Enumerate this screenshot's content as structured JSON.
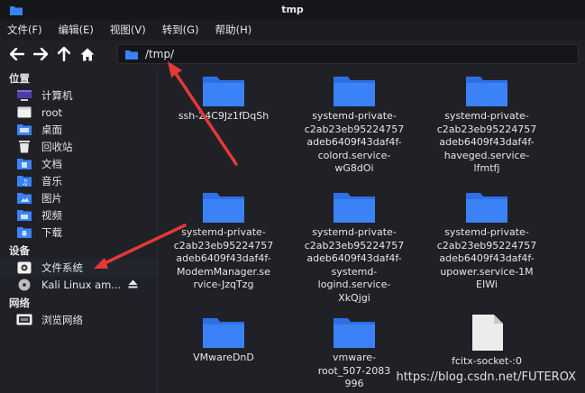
{
  "window": {
    "title": "tmp"
  },
  "menu": [
    "文件(F)",
    "编辑(E)",
    "视图(V)",
    "转到(G)",
    "帮助(H)"
  ],
  "toolbar": {
    "path": "/tmp/"
  },
  "sidebar": {
    "sections": [
      {
        "heading": "位置",
        "items": [
          {
            "label": "计算机",
            "icon": "computer-icon"
          },
          {
            "label": "root",
            "icon": "home-folder-icon"
          },
          {
            "label": "桌面",
            "icon": "desktop-folder-icon"
          },
          {
            "label": "回收站",
            "icon": "trash-icon"
          },
          {
            "label": "文档",
            "icon": "documents-folder-icon"
          },
          {
            "label": "音乐",
            "icon": "music-folder-icon"
          },
          {
            "label": "图片",
            "icon": "pictures-folder-icon"
          },
          {
            "label": "视频",
            "icon": "videos-folder-icon"
          },
          {
            "label": "下载",
            "icon": "downloads-folder-icon"
          }
        ]
      },
      {
        "heading": "设备",
        "items": [
          {
            "label": "文件系统",
            "icon": "drive-icon"
          },
          {
            "label": "Kali Linux am...",
            "icon": "disc-icon",
            "eject": true
          }
        ]
      },
      {
        "heading": "网络",
        "items": [
          {
            "label": "浏览网络",
            "icon": "network-icon"
          }
        ]
      }
    ]
  },
  "files": [
    {
      "name": "ssh-24C9Jz1fDqSh",
      "type": "folder"
    },
    {
      "name": "systemd-private-c2ab23eb95224757adeb6409f43daf4f-colord.service-wG8dOi",
      "type": "folder"
    },
    {
      "name": "systemd-private-c2ab23eb95224757adeb6409f43daf4f-haveged.service-lfmtfj",
      "type": "folder"
    },
    {
      "name": "systemd-private-c2ab23eb95224757adeb6409f43daf4f-ModemManager.service-JzqTzg",
      "type": "folder"
    },
    {
      "name": "systemd-private-c2ab23eb95224757adeb6409f43daf4f-systemd-logind.service-XkQjgi",
      "type": "folder"
    },
    {
      "name": "systemd-private-c2ab23eb95224757adeb6409f43daf4f-upower.service-1MEIWi",
      "type": "folder"
    },
    {
      "name": "VMwareDnD",
      "type": "folder"
    },
    {
      "name": "vmware-root_507-2083...996",
      "type": "folder"
    },
    {
      "name": "fcitx-socket-:0",
      "type": "file"
    }
  ],
  "labels_display": [
    [
      "ssh-24C9Jz1fDqSh"
    ],
    [
      "systemd-private-",
      "c2ab23eb95224757",
      "adeb6409f43daf4f-",
      "colord.service-",
      "wG8dOi"
    ],
    [
      "systemd-private-",
      "c2ab23eb95224757",
      "adeb6409f43daf4f-",
      "haveged.service-",
      "lfmtfj"
    ],
    [
      "systemd-private-",
      "c2ab23eb95224757",
      "adeb6409f43daf4f-",
      "ModemManager.se",
      "rvice-JzqTzg"
    ],
    [
      "systemd-private-",
      "c2ab23eb95224757",
      "adeb6409f43daf4f-",
      "systemd-",
      "logind.service-",
      "XkQjgi"
    ],
    [
      "systemd-private-",
      "c2ab23eb95224757",
      "adeb6409f43daf4f-",
      "upower.service-1M",
      "EIWi"
    ],
    [
      "VMwareDnD"
    ],
    [
      "vmware-",
      "root_507-2083",
      "996"
    ],
    [
      "fcitx-socket-:0"
    ]
  ],
  "watermark": "https://blog.csdn.net/FUTEROX",
  "colors": {
    "folder": "#3b82f6",
    "folder_tab": "#2563eb",
    "annotation": "#e53935",
    "background": "#1f2127"
  }
}
